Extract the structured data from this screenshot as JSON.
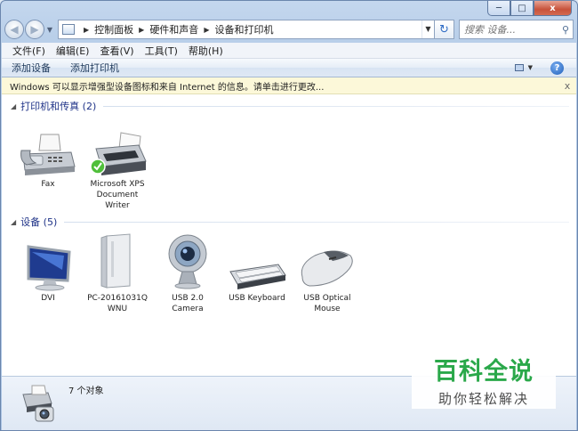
{
  "window": {
    "caption": {
      "minimize": "─",
      "maximize": "□",
      "close": "x"
    }
  },
  "navigation": {
    "back_glyph": "◀",
    "forward_glyph": "▶",
    "breadcrumb": [
      "控制面板",
      "硬件和声音",
      "设备和打印机"
    ],
    "search_placeholder": "搜索 设备...",
    "refresh_glyph": "↻"
  },
  "menu": [
    "文件(F)",
    "编辑(E)",
    "查看(V)",
    "工具(T)",
    "帮助(H)"
  ],
  "commands": [
    "添加设备",
    "添加打印机"
  ],
  "help_glyph": "?",
  "infobar": {
    "text": "Windows 可以显示增强型设备图标和来自 Internet 的信息。请单击进行更改...",
    "close": "x"
  },
  "groups": [
    {
      "title": "打印机和传真 (2)",
      "devices": [
        {
          "label": "Fax",
          "icon": "fax-icon"
        },
        {
          "label": "Microsoft XPS Document Writer",
          "icon": "printer-icon",
          "default": true
        }
      ]
    },
    {
      "title": "设备 (5)",
      "devices": [
        {
          "label": "DVI",
          "icon": "monitor-icon"
        },
        {
          "label": "PC-20161031Q WNU",
          "icon": "computer-icon"
        },
        {
          "label": "USB 2.0 Camera",
          "icon": "webcam-icon"
        },
        {
          "label": "USB Keyboard",
          "icon": "keyboard-icon"
        },
        {
          "label": "USB Optical Mouse",
          "icon": "mouse-icon"
        }
      ]
    }
  ],
  "details": {
    "count": "7 个对象"
  },
  "watermark": {
    "title": "百科全说",
    "subtitle": "助你轻松解决"
  },
  "colors": {
    "group_header": "#1e3287",
    "infobar_bg": "#fcf8d9",
    "watermark_green": "#2aa84a"
  }
}
